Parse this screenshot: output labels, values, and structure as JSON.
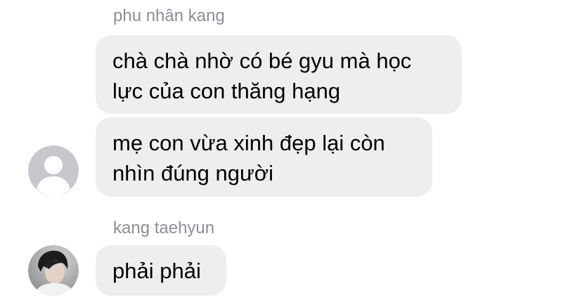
{
  "messages": [
    {
      "sender": "phu nhân kang",
      "bubbles": [
        {
          "lines": [
            "chà chà nhờ có bé gyu mà học",
            "lực của con thăng hạng"
          ]
        },
        {
          "lines": [
            "mẹ con vừa xinh đẹp lại còn",
            "nhìn đúng người"
          ]
        }
      ],
      "avatar_icon": "default-person-avatar"
    },
    {
      "sender": "kang taehyun",
      "bubbles": [
        {
          "lines": [
            "phải phải"
          ]
        }
      ],
      "avatar_icon": "profile-photo-avatar"
    }
  ],
  "colors": {
    "bubble_bg": "#eeeeef",
    "name_text": "#8e8e93",
    "message_text": "#000000",
    "default_avatar_bg": "#c7c7cc"
  }
}
